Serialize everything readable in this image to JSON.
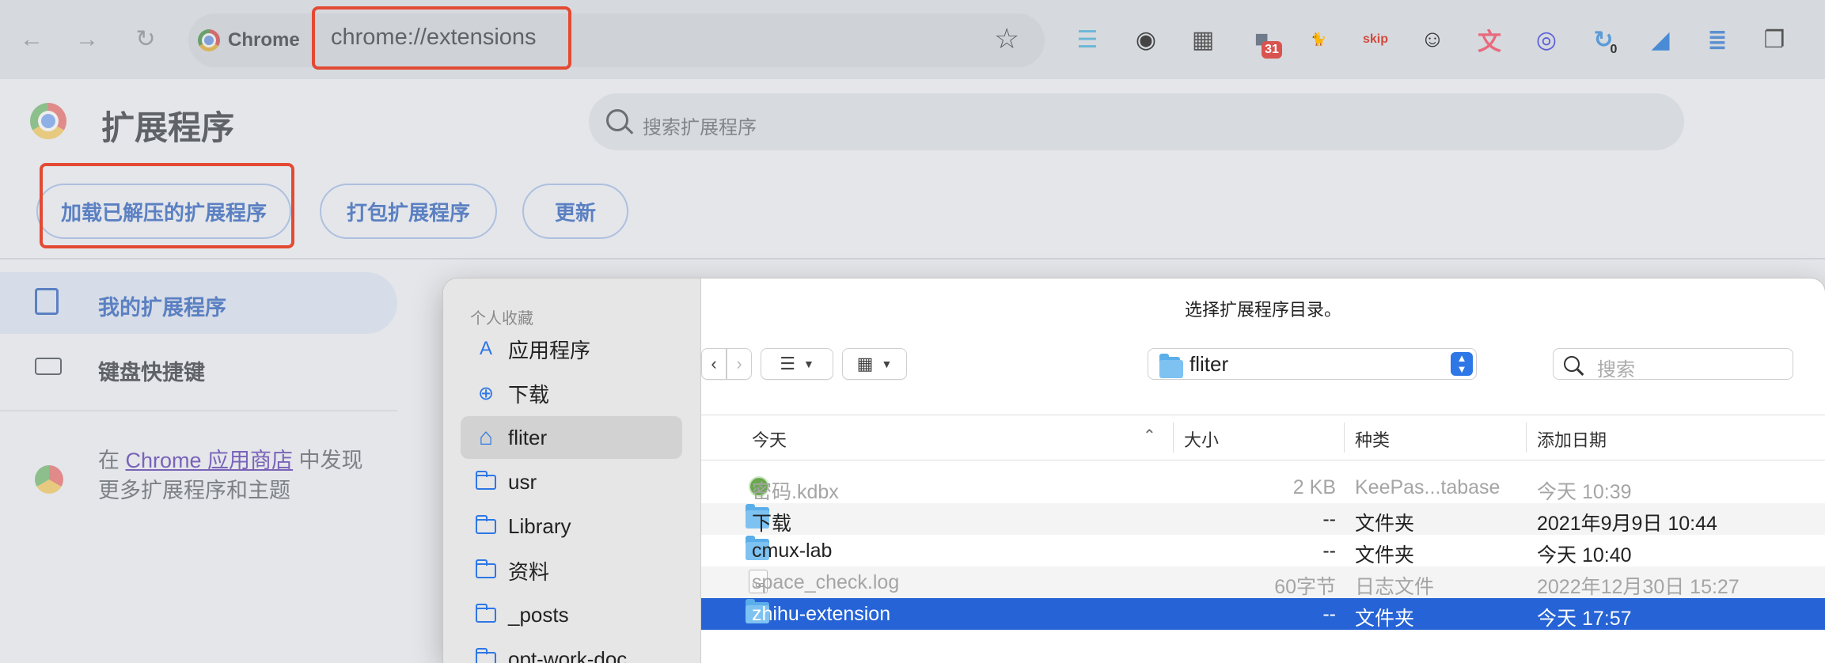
{
  "browser": {
    "chip_label": "Chrome",
    "url": "chrome://extensions",
    "extension_icons": [
      {
        "name": "filter-icon",
        "glyph": "☰",
        "color": "#6bb6d6",
        "badge": ""
      },
      {
        "name": "github-icon",
        "glyph": "◉",
        "color": "#444444",
        "badge": ""
      },
      {
        "name": "qrcode-icon",
        "glyph": "▦",
        "color": "#555555",
        "badge": ""
      },
      {
        "name": "apps-icon",
        "glyph": "■",
        "color": "#6f7a8a",
        "badge": "31"
      },
      {
        "name": "cat-icon",
        "glyph": "🐈",
        "color": "#d9a52a",
        "badge": ""
      },
      {
        "name": "skip-ad-icon",
        "glyph": "skip",
        "color": "#d04a3c",
        "badge": ""
      },
      {
        "name": "face-icon",
        "glyph": "☺",
        "color": "#333333",
        "badge": ""
      },
      {
        "name": "translate-icon",
        "glyph": "文",
        "color": "#e86a7d",
        "badge": ""
      },
      {
        "name": "circle-icon",
        "glyph": "◎",
        "color": "#5b5fd8",
        "badge": ""
      },
      {
        "name": "refresh-count-icon",
        "glyph": "↻",
        "color": "#5b9bd8",
        "badge": "0"
      },
      {
        "name": "feather-icon",
        "glyph": "◢",
        "color": "#4a8bd6",
        "badge": ""
      },
      {
        "name": "reader-icon",
        "glyph": "≣",
        "color": "#5a8fd0",
        "badge": ""
      },
      {
        "name": "copy-icon",
        "glyph": "❐",
        "color": "#555555",
        "badge": ""
      }
    ]
  },
  "page": {
    "title": "扩展程序",
    "search_placeholder": "搜索扩展程序",
    "buttons": {
      "load_unpacked": "加载已解压的扩展程序",
      "pack": "打包扩展程序",
      "update": "更新"
    },
    "nav": {
      "my_extensions": "我的扩展程序",
      "shortcuts": "键盘快捷键"
    },
    "store": {
      "prefix": "在 ",
      "link": "Chrome 应用商店",
      "suffix": " 中发现",
      "line2": "更多扩展程序和主题"
    }
  },
  "dialog": {
    "title": "选择扩展程序目录。",
    "favorites_header": "个人收藏",
    "sidebar": [
      {
        "label": "应用程序",
        "icon": "applications-icon",
        "selected": false
      },
      {
        "label": "下载",
        "icon": "downloads-icon",
        "selected": false
      },
      {
        "label": "fliter",
        "icon": "home-icon",
        "selected": true
      },
      {
        "label": "usr",
        "icon": "folder-icon",
        "selected": false
      },
      {
        "label": "Library",
        "icon": "folder-icon",
        "selected": false
      },
      {
        "label": "资料",
        "icon": "folder-icon",
        "selected": false
      },
      {
        "label": "_posts",
        "icon": "folder-icon",
        "selected": false
      },
      {
        "label": "opt-work-doc",
        "icon": "folder-icon",
        "selected": false
      }
    ],
    "location": "fliter",
    "search_placeholder": "搜索",
    "columns": {
      "name": "今天",
      "size": "大小",
      "kind": "种类",
      "date": "添加日期"
    },
    "files": [
      {
        "name": "密码.kdbx",
        "size": "2 KB",
        "kind": "KeePas...tabase",
        "date": "今天 10:39",
        "icon": "kdbx",
        "enabled": false,
        "selected": false
      },
      {
        "name": "下载",
        "size": "--",
        "kind": "文件夹",
        "date": "2021年9月9日 10:44",
        "icon": "folder",
        "enabled": true,
        "selected": false
      },
      {
        "name": "cmux-lab",
        "size": "--",
        "kind": "文件夹",
        "date": "今天 10:40",
        "icon": "folder",
        "enabled": true,
        "selected": false
      },
      {
        "name": "space_check.log",
        "size": "60字节",
        "kind": "日志文件",
        "date": "2022年12月30日 15:27",
        "icon": "log",
        "enabled": false,
        "selected": false
      },
      {
        "name": "zhihu-extension",
        "size": "--",
        "kind": "文件夹",
        "date": "今天 17:57",
        "icon": "folder",
        "enabled": true,
        "selected": true
      }
    ]
  }
}
